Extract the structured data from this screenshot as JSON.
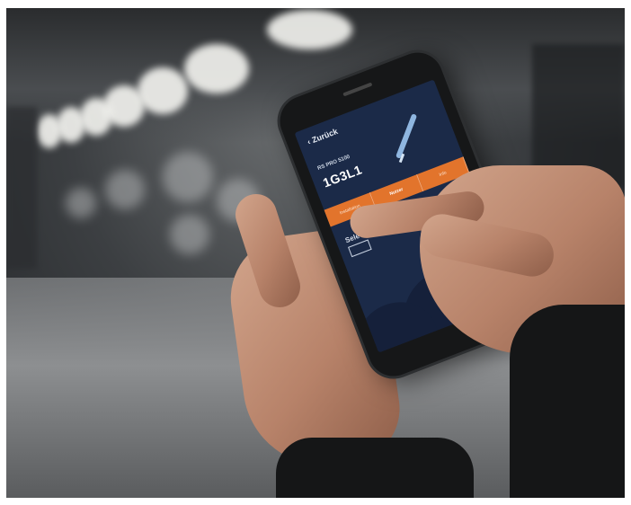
{
  "screen": {
    "back_label": "‹ Zurück",
    "model": "RS PRO 5100",
    "device_id": "1G3L1",
    "tabs": [
      {
        "label": "Installation",
        "active": false
      },
      {
        "label": "Nutzer",
        "active": true
      },
      {
        "label": "Info",
        "active": false
      }
    ],
    "select_label": "Sele"
  },
  "colors": {
    "screen_bg": "#1b2a48",
    "tab_accent": "#e2742c"
  }
}
